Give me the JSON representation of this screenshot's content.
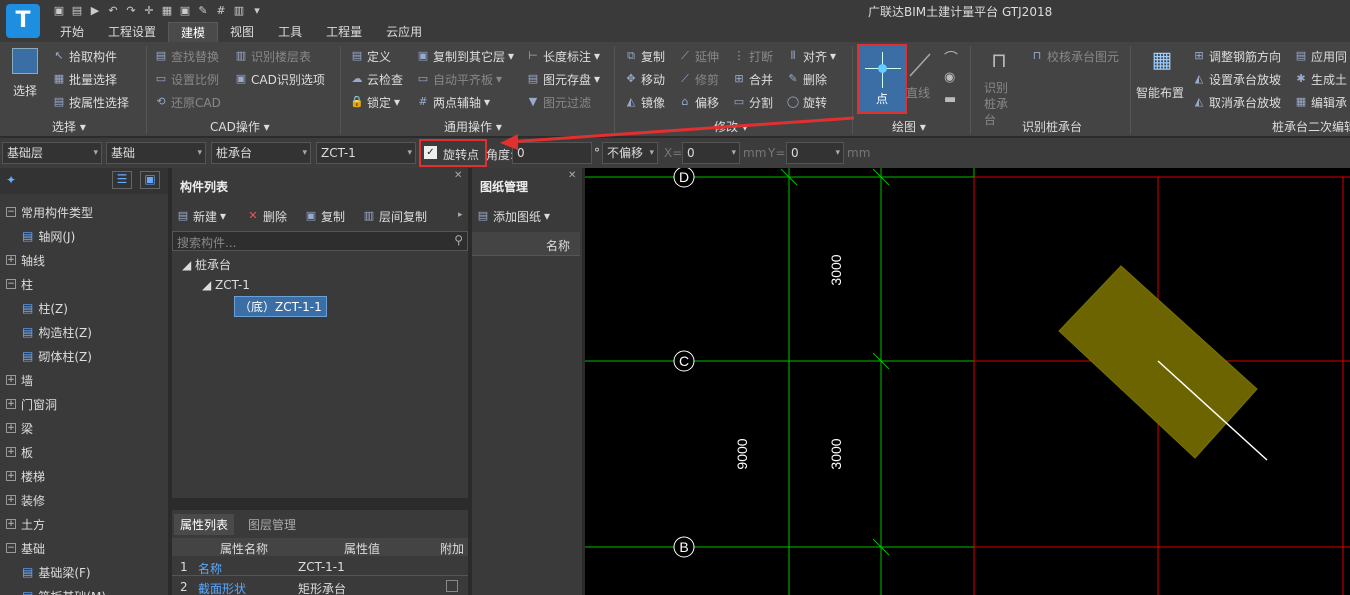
{
  "logo": "T",
  "app_title": "广联达BIM土建计量平台 GTJ2018",
  "menu_tabs": [
    "开始",
    "工程设置",
    "建模",
    "视图",
    "工具",
    "工程量",
    "云应用"
  ],
  "active_tab": "建模",
  "ribbon": {
    "select": {
      "label": "选择",
      "items": [
        "拾取构件",
        "批量选择",
        "按属性选择"
      ],
      "group": "选择"
    },
    "cad": {
      "items": [
        "查找替换",
        "识别楼层表",
        "设置比例",
        "CAD识别选项",
        "还原CAD"
      ],
      "group": "CAD操作"
    },
    "common": {
      "items": [
        "定义",
        "复制到其它层",
        "长度标注",
        "云检查",
        "自动平齐板",
        "图元存盘",
        "锁定",
        "两点辅轴",
        "图元过滤"
      ],
      "group": "通用操作"
    },
    "modify": {
      "items": [
        "复制",
        "延伸",
        "打断",
        "对齐",
        "移动",
        "修剪",
        "合并",
        "删除",
        "镜像",
        "偏移",
        "分割",
        "旋转"
      ],
      "group": "修改"
    },
    "draw": {
      "point": "点",
      "line": "直线",
      "group": "绘图"
    },
    "recog": {
      "big": "识别桩承台",
      "small": "校核承台图元",
      "group": "识别桩承台"
    },
    "smart": {
      "label": "智能布置",
      "items": [
        "调整钢筋方向",
        "设置承台放坡",
        "取消承台放坡"
      ],
      "extra": [
        "应用同",
        "生成土",
        "编辑承"
      ],
      "group": "桩承台二次编辑"
    }
  },
  "toolrow": {
    "floor": "基础层",
    "type": "基础",
    "component": "桩承台",
    "spec": "ZCT-1",
    "rotate_point_label": "旋转点",
    "rotate_checked": true,
    "angle_label": "角度:",
    "angle_value": "0",
    "deg": "°",
    "offset": "不偏移",
    "x_label": "X=",
    "x_value": "0",
    "mm1": "mm",
    "y_label": "Y=",
    "y_value": "0",
    "mm2": "mm"
  },
  "left_tree": [
    {
      "label": "常用构件类型",
      "kind": "expanded"
    },
    {
      "label": "轴网(J)",
      "kind": "child",
      "icon": "grid-icon"
    },
    {
      "label": "轴线",
      "kind": "plus"
    },
    {
      "label": "柱",
      "kind": "expanded"
    },
    {
      "label": "柱(Z)",
      "kind": "child",
      "icon": "column-icon"
    },
    {
      "label": "构造柱(Z)",
      "kind": "child",
      "icon": "column-icon"
    },
    {
      "label": "砌体柱(Z)",
      "kind": "child",
      "icon": "column-icon"
    },
    {
      "label": "墙",
      "kind": "plus"
    },
    {
      "label": "门窗洞",
      "kind": "plus"
    },
    {
      "label": "梁",
      "kind": "plus"
    },
    {
      "label": "板",
      "kind": "plus"
    },
    {
      "label": "楼梯",
      "kind": "plus"
    },
    {
      "label": "装修",
      "kind": "plus"
    },
    {
      "label": "土方",
      "kind": "plus"
    },
    {
      "label": "基础",
      "kind": "expanded"
    },
    {
      "label": "基础梁(F)",
      "kind": "child",
      "icon": "beam-icon"
    },
    {
      "label": "筏板基础(M)",
      "kind": "child",
      "icon": "slab-icon"
    }
  ],
  "complist": {
    "title": "构件列表",
    "actions": [
      "新建",
      "删除",
      "复制",
      "层间复制"
    ],
    "search_placeholder": "搜索构件...",
    "tree": [
      "桩承台",
      "ZCT-1",
      "（底）ZCT-1-1"
    ]
  },
  "drawmgr": {
    "title": "图纸管理",
    "action": "添加图纸",
    "col": "名称"
  },
  "props": {
    "tabs": [
      "属性列表",
      "图层管理"
    ],
    "cols": [
      "属性名称",
      "属性值",
      "附加"
    ],
    "rows": [
      [
        "1",
        "名称",
        "ZCT-1-1"
      ],
      [
        "2",
        "截面形状",
        "矩形承台"
      ]
    ]
  },
  "canvas": {
    "axes": [
      "D",
      "C",
      "B"
    ],
    "dims": [
      "3000",
      "3000",
      "9000"
    ],
    "colors": {
      "grid": "#00c000",
      "red": "#e00000",
      "pilecap": "#6b6400",
      "axis": "#ffffff"
    }
  }
}
